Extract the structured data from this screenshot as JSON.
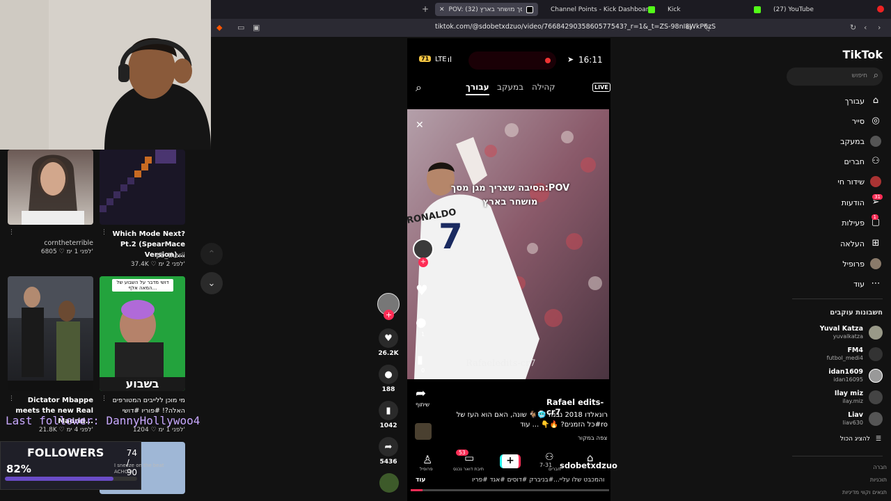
{
  "browser": {
    "tabs": [
      {
        "label": "POV: מסך מושחר בארץ (32)",
        "active": true
      },
      {
        "label": "Channel Points - Kick Dashboard"
      },
      {
        "label": "Kick"
      },
      {
        "label": "(27) YouTube"
      }
    ],
    "new_tab": "+",
    "close_tab": "✕",
    "url": "tiktok.com/@sdobetxdzuo/video/7668429035860577543?_r=1&_t=ZS-98nI8WkP6zS"
  },
  "overlay": {
    "last_follower": "Last follower: DannyHollywoo4",
    "followers_label": "FOLLOWERS",
    "followers_count": "74 / 90",
    "followers_percent": "82%",
    "followers_progress": 0.82,
    "follower_subtext": "I sneeze on the beat ACHOO"
  },
  "feed_cards": [
    {
      "title": "",
      "author": "corntheterrible",
      "likes": "6805",
      "age": "לפני 1 ימ'"
    },
    {
      "title": "Which Mode Next? Pt.2 (SpearMace Version)...",
      "author": "pb_thorii",
      "likes": "37.4K",
      "age": "לפני 2 ימ'"
    },
    {
      "title": "Dictator Mbappe meets the new Real Madrid...",
      "author": "",
      "likes": "21.8K",
      "age": "לפני 4 ימ'",
      "overlay_text": ""
    },
    {
      "title": "מי מוכן ללייבים המטורפים האלה?! #פוריו #דושי",
      "author": "",
      "likes": "1204",
      "age": "לפני 1 ימ'",
      "thumb_caption": "דושי מדבר על השבוע של המאה אלף...",
      "thumb_banner": "בשבוע"
    }
  ],
  "phone": {
    "status_net": "LTE",
    "status_time": "16:11",
    "battery": "71",
    "tabs": [
      "עבורך",
      "במעקב",
      "קהילה"
    ],
    "live_label": "LIVE",
    "video_text": "הסיבה שצריך מגן מסך:POV מושחר בארץ",
    "video_watermark": "Rafaeledits-cr7",
    "likes_inner": "",
    "comments_inner": "1",
    "saves_inner": "0",
    "share_label": "שיתוף",
    "channel_name": "Rafael edits-cr7",
    "caption": "רונאלדו 2018 נבנה 🥶🐐 שונה, האם הוא העז של כל הזמנים? 🔥👇 ... עוד#ro",
    "view_source": "צפה במקור",
    "bottom_nav": [
      "sdobetxdzuo",
      "חברים",
      "+",
      "תיבת דואר נכנס",
      "פרופיל"
    ],
    "inbox_badge": "53",
    "friends_sub": "7-31",
    "subtitle_line": "והמכבט שלו עליי...#בניברק #דוסים #אגד #פריו",
    "subtitle_more": "עוד"
  },
  "actions": {
    "likes": "26.2K",
    "comments": "188",
    "saves": "1042",
    "shares": "5436"
  },
  "tiktok_nav": {
    "logo": "TikTok",
    "search_placeholder": "חיפוש",
    "items": [
      {
        "label": "עבורך",
        "icon": "home-icon"
      },
      {
        "label": "סייר",
        "icon": "compass-icon"
      },
      {
        "label": "במעקב",
        "icon": "following-icon"
      },
      {
        "label": "חברים",
        "icon": "friends-icon"
      },
      {
        "label": "שידור חי",
        "icon": "live-icon"
      },
      {
        "label": "הודעות",
        "icon": "messages-icon",
        "badge": "31"
      },
      {
        "label": "פעילות",
        "icon": "activity-icon",
        "badge": "1"
      },
      {
        "label": "העלאה",
        "icon": "upload-icon"
      },
      {
        "label": "פרופיל",
        "icon": "profile-icon"
      },
      {
        "label": "עוד",
        "icon": "more-icon"
      }
    ],
    "following_header": "חשבונות עוקבים",
    "following": [
      {
        "name": "Yuval Katza",
        "handle": "yuvalkatza"
      },
      {
        "name": "FM4",
        "handle": "futbol_medi4"
      },
      {
        "name": "idan1609",
        "handle": "idan16095"
      },
      {
        "name": "Ilay miz",
        "handle": "ilay.miz"
      },
      {
        "name": "Liav",
        "handle": "liav630"
      }
    ],
    "show_all": "להציג הכול",
    "footer": [
      "חברה",
      "תוכניות",
      "תנאים וקווי מדיניות"
    ]
  },
  "colors": {
    "accent_red": "#fe2c55",
    "tab_bar": "#1c1b22",
    "address_bar": "#2b2a33",
    "overlay_purple": "#c8a8ff"
  }
}
